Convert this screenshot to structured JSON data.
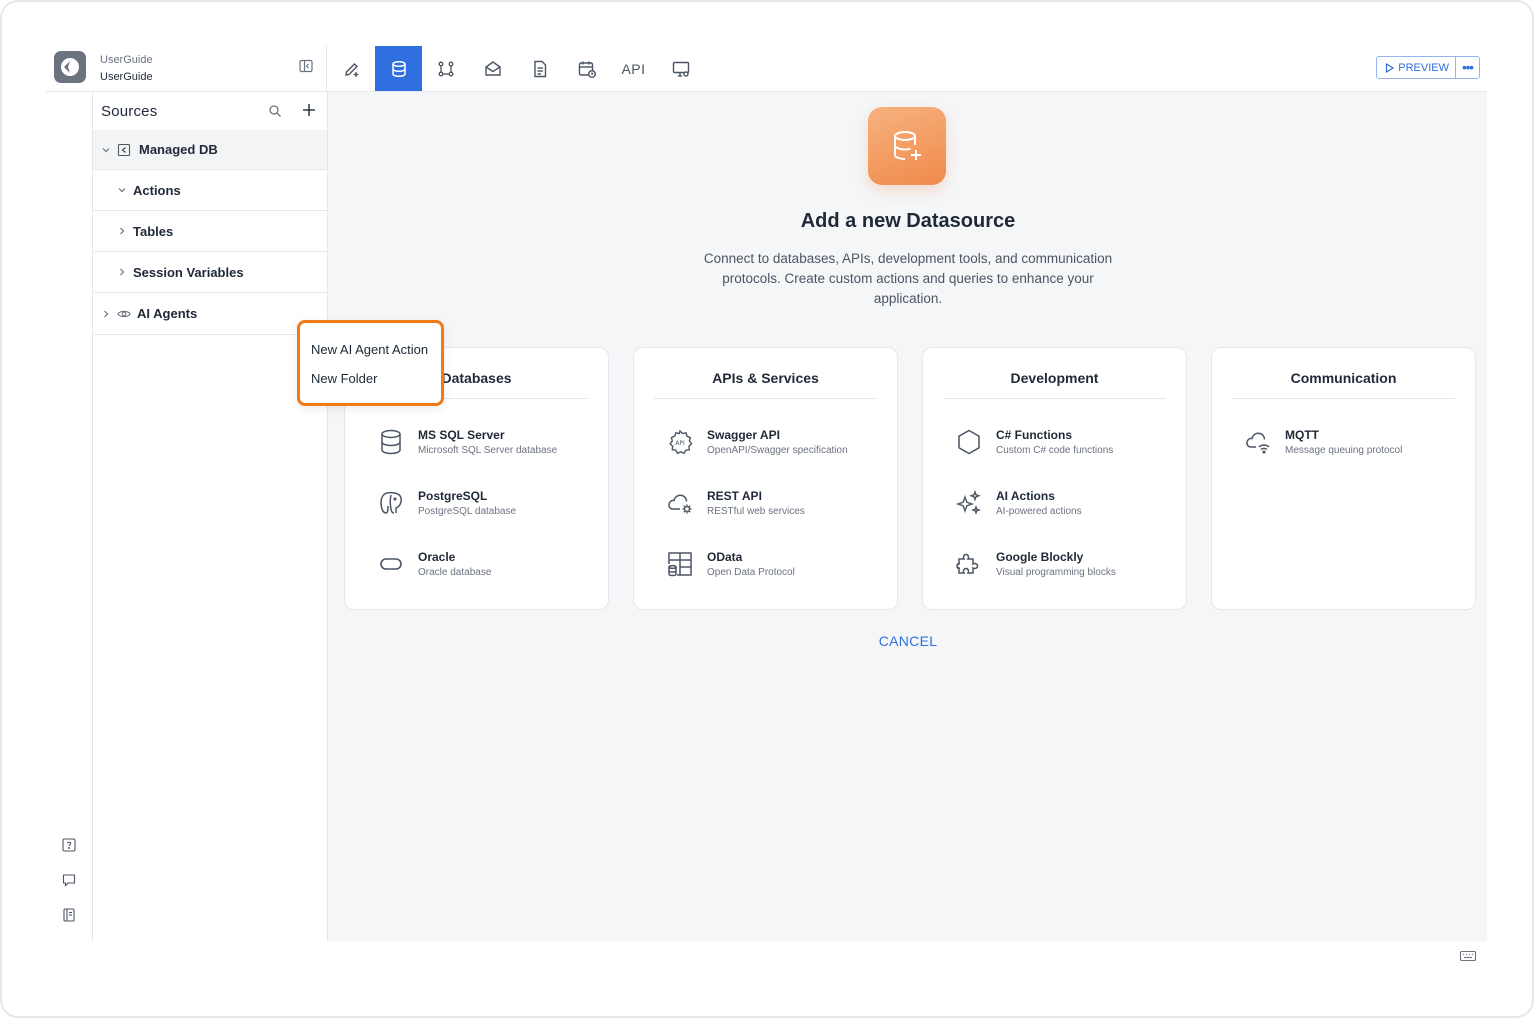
{
  "app": {
    "project_line1": "UserGuide",
    "project_line2": "UserGuide"
  },
  "toolbar": {
    "tabs": [
      {
        "icon": "pencil-plus-icon"
      },
      {
        "icon": "database-icon",
        "active": true
      },
      {
        "icon": "workflow-icon"
      },
      {
        "icon": "mail-icon"
      },
      {
        "icon": "document-icon"
      },
      {
        "icon": "calendar-clock-icon"
      },
      {
        "label": "API"
      },
      {
        "icon": "monitor-settings-icon"
      }
    ],
    "preview_label": "PREVIEW",
    "more_label": "•••"
  },
  "sidebar": {
    "title": "Sources",
    "tree": {
      "managed_db": "Managed DB",
      "actions": "Actions",
      "tables": "Tables",
      "session_variables": "Session Variables",
      "ai_agents": "AI Agents"
    }
  },
  "context_menu": {
    "items": [
      "New AI Agent Action",
      "New Folder"
    ]
  },
  "main": {
    "title": "Add a new Datasource",
    "subtitle": "Connect to databases, APIs, development tools, and communication protocols. Create custom actions and queries to enhance your application.",
    "categories": [
      {
        "title": "Databases",
        "items": [
          {
            "name": "MS SQL Server",
            "desc": "Microsoft SQL Server database",
            "icon": "database-icon"
          },
          {
            "name": "PostgreSQL",
            "desc": "PostgreSQL database",
            "icon": "elephant-icon"
          },
          {
            "name": "Oracle",
            "desc": "Oracle database",
            "icon": "oracle-icon"
          }
        ]
      },
      {
        "title": "APIs & Services",
        "items": [
          {
            "name": "Swagger API",
            "desc": "OpenAPI/Swagger specification",
            "icon": "api-gear-icon"
          },
          {
            "name": "REST API",
            "desc": "RESTful web services",
            "icon": "cloud-cog-icon"
          },
          {
            "name": "OData",
            "desc": "Open Data Protocol",
            "icon": "table-db-icon"
          }
        ]
      },
      {
        "title": "Development",
        "items": [
          {
            "name": "C# Functions",
            "desc": "Custom C# code functions",
            "icon": "hexagon-icon"
          },
          {
            "name": "AI Actions",
            "desc": "AI-powered actions",
            "icon": "sparkles-icon"
          },
          {
            "name": "Google Blockly",
            "desc": "Visual programming blocks",
            "icon": "puzzle-icon"
          }
        ]
      },
      {
        "title": "Communication",
        "items": [
          {
            "name": "MQTT",
            "desc": "Message queuing protocol",
            "icon": "cloud-wifi-icon"
          }
        ]
      }
    ],
    "cancel_label": "CANCEL"
  },
  "colors": {
    "accent": "#2f6fe0",
    "highlight": "#f07b16",
    "hero_gradient": "#f08a4b"
  }
}
